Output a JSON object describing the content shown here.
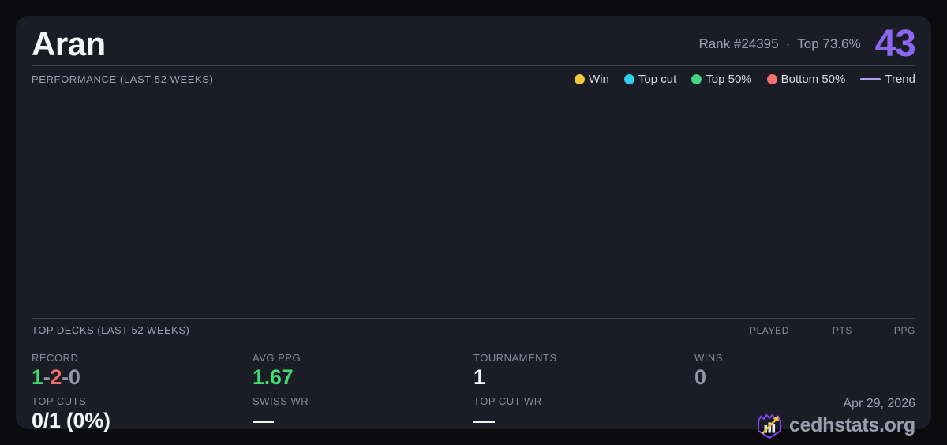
{
  "colors": {
    "page_bg": "#0b0b0d",
    "card_bg": "#1a1d26",
    "divider": "#3a4150",
    "score_purple": "#8b66ee",
    "trend_purple": "#b3a0f3",
    "win_yellow": "#eec73d",
    "topcut_cyan": "#2fd0e8",
    "top50_green": "#46d383",
    "bottom50_red": "#f4706f",
    "value_green": "#3fdc73",
    "value_red": "#f56a6a",
    "muted_text": "#848a98",
    "gray_text": "#9aa1b0",
    "white_text": "#f5f6f8"
  },
  "header": {
    "title": "Aran",
    "rank": "Rank #24395",
    "separator": "·",
    "percentile": "Top 73.6%",
    "score": "43"
  },
  "performance": {
    "title": "PERFORMANCE (LAST 52 WEEKS)",
    "legend": [
      {
        "label": "Win",
        "color": "#eec73d",
        "marker": "dot"
      },
      {
        "label": "Top cut",
        "color": "#2fd0e8",
        "marker": "dot"
      },
      {
        "label": "Top 50%",
        "color": "#46d383",
        "marker": "dot"
      },
      {
        "label": "Bottom 50%",
        "color": "#f4706f",
        "marker": "dot"
      },
      {
        "label": "Trend",
        "color": "#b3a0f3",
        "marker": "line"
      }
    ]
  },
  "chart_data": {
    "type": "scatter",
    "title": "PERFORMANCE (LAST 52 WEEKS)",
    "x": [],
    "series": [
      {
        "name": "Win",
        "color": "#eec73d",
        "points": []
      },
      {
        "name": "Top cut",
        "color": "#2fd0e8",
        "points": []
      },
      {
        "name": "Top 50%",
        "color": "#46d383",
        "points": []
      },
      {
        "name": "Bottom 50%",
        "color": "#f4706f",
        "points": []
      },
      {
        "name": "Trend",
        "color": "#b3a0f3",
        "points": []
      }
    ],
    "legend_position": "top-right",
    "grid": false,
    "axes_visible": false,
    "note": "plot area rendered empty - no visible data points in the last 52 weeks window"
  },
  "top_decks": {
    "title": "TOP DECKS (LAST 52 WEEKS)",
    "columns": [
      "PLAYED",
      "PTS",
      "PPG"
    ],
    "rows": []
  },
  "stats": {
    "record": {
      "label": "RECORD",
      "win": "1",
      "sep1": "-",
      "loss": "2",
      "sep2": "-",
      "draw": "0"
    },
    "avg_ppg": {
      "label": "AVG PPG",
      "value": "1.67"
    },
    "tournaments": {
      "label": "TOURNAMENTS",
      "value": "1"
    },
    "wins": {
      "label": "WINS",
      "value": "0"
    },
    "top_cuts": {
      "label": "TOP CUTS",
      "value": "0/1 (0%)"
    },
    "swiss_wr": {
      "label": "SWISS WR",
      "value": "—"
    },
    "top_cut_wr": {
      "label": "TOP CUT WR",
      "value": "—"
    }
  },
  "footer": {
    "date": "Apr 29, 2026",
    "brand": "cedhstats.org"
  }
}
